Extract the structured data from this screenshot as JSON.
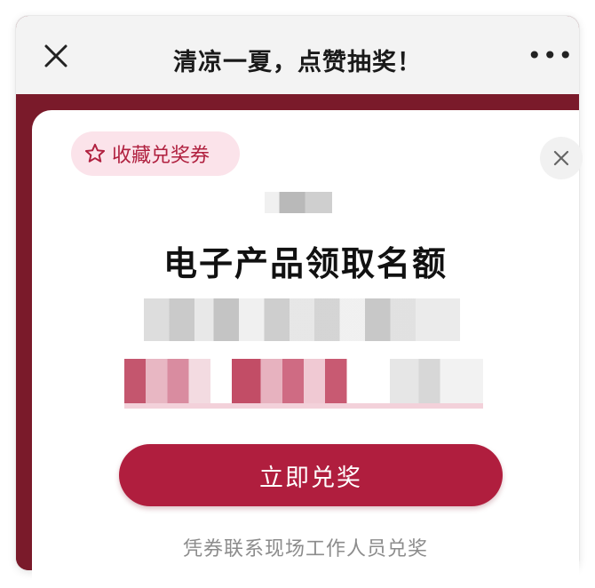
{
  "header": {
    "title": "清凉一夏，点赞抽奖！",
    "more_glyph": "•••",
    "close_icon": "close-icon",
    "more_icon": "more-icon"
  },
  "card": {
    "collect_chip": {
      "label": "收藏兑奖券",
      "icon": "star-outline-icon"
    },
    "headline": "电子产品领取名额",
    "redeem_button": "立即兑奖",
    "footnote": "凭券联系现场工作人员兑奖",
    "close_icon": "close-icon"
  },
  "colors": {
    "accent": "#b01e3e",
    "chip_bg": "#fbe3ea",
    "backdrop": "#7a1a2a"
  }
}
